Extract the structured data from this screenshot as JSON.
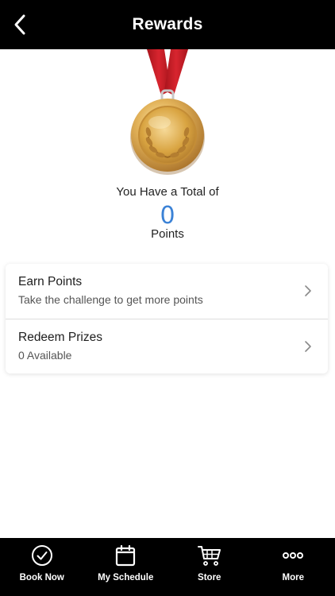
{
  "header": {
    "title": "Rewards",
    "back_icon": "chevron-left-icon"
  },
  "rewards": {
    "total_label": "You Have a Total of",
    "points": "0",
    "points_label": "Points",
    "medal_icon": "gold-medal-icon"
  },
  "options": [
    {
      "title": "Earn Points",
      "subtitle": "Take the challenge to get more points",
      "icon": "chevron-right-icon"
    },
    {
      "title": "Redeem Prizes",
      "subtitle": "0 Available",
      "icon": "chevron-right-icon"
    }
  ],
  "tabbar": [
    {
      "label": "Book Now",
      "icon": "check-circle-icon"
    },
    {
      "label": "My Schedule",
      "icon": "calendar-icon"
    },
    {
      "label": "Store",
      "icon": "cart-icon"
    },
    {
      "label": "More",
      "icon": "more-dots-icon"
    }
  ],
  "colors": {
    "header_bg": "#000000",
    "points_accent": "#3b82d6",
    "ribbon": "#c8232c",
    "medal_gold": "#d9a441"
  }
}
